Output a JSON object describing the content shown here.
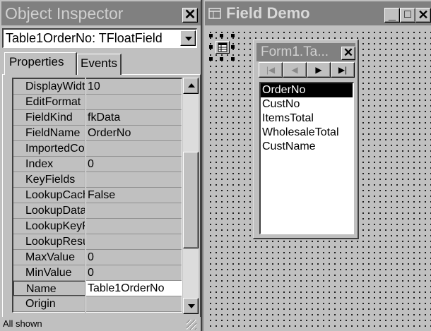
{
  "object_inspector": {
    "title": "Object Inspector",
    "close_glyph": "✕",
    "selector_value": "Table1OrderNo: TFloatField",
    "tabs": [
      {
        "label": "Properties",
        "active": true
      },
      {
        "label": "Events",
        "active": false
      }
    ],
    "properties": [
      {
        "name": "DisplayWidth",
        "value": "10"
      },
      {
        "name": "EditFormat",
        "value": ""
      },
      {
        "name": "FieldKind",
        "value": "fkData"
      },
      {
        "name": "FieldName",
        "value": "OrderNo"
      },
      {
        "name": "ImportedConstraint",
        "value": ""
      },
      {
        "name": "Index",
        "value": "0"
      },
      {
        "name": "KeyFields",
        "value": ""
      },
      {
        "name": "LookupCache",
        "value": "False"
      },
      {
        "name": "LookupDataSet",
        "value": ""
      },
      {
        "name": "LookupKeyFields",
        "value": ""
      },
      {
        "name": "LookupResultField",
        "value": ""
      },
      {
        "name": "MaxValue",
        "value": "0"
      },
      {
        "name": "MinValue",
        "value": "0"
      },
      {
        "name": "Name",
        "value": "Table1OrderNo",
        "selected": true
      },
      {
        "name": "Origin",
        "value": ""
      }
    ],
    "status": "All shown"
  },
  "field_demo": {
    "title": "Field Demo",
    "window_buttons": {
      "minimize": "_",
      "maximize": "□",
      "close": "✕"
    },
    "component_icon": "table-component-icon"
  },
  "fields_editor": {
    "title": "Form1.Ta...",
    "close_glyph": "✕",
    "nav_buttons": [
      {
        "glyph": "|◀",
        "name": "nav-first-button",
        "enabled": false
      },
      {
        "glyph": "◀",
        "name": "nav-prior-button",
        "enabled": false
      },
      {
        "glyph": "▶",
        "name": "nav-next-button",
        "enabled": true
      },
      {
        "glyph": "▶|",
        "name": "nav-last-button",
        "enabled": true
      }
    ],
    "fields": [
      {
        "label": "OrderNo",
        "selected": true
      },
      {
        "label": "CustNo",
        "selected": false
      },
      {
        "label": "ItemsTotal",
        "selected": false
      },
      {
        "label": "WholesaleTotal",
        "selected": false
      },
      {
        "label": "CustName",
        "selected": false
      }
    ]
  }
}
